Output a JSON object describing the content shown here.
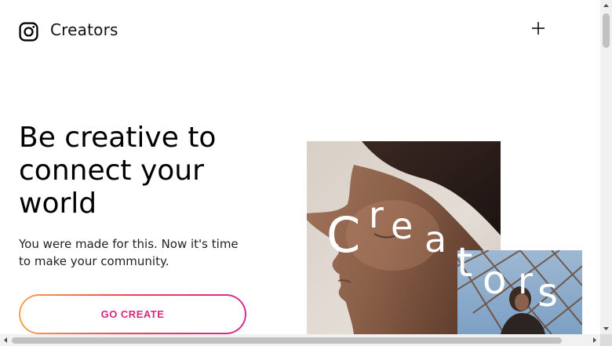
{
  "header": {
    "brand": "Creators",
    "logo_icon": "instagram-logo-icon",
    "menu_icon": "plus-icon"
  },
  "hero": {
    "title_lines": [
      "Be creative to",
      "connect your",
      "world"
    ],
    "subtitle_lines": [
      "You were made for this. Now it's time",
      "to make your community."
    ],
    "cta_label": "GO CREATE"
  },
  "artwork": {
    "letters": [
      "C",
      "r",
      "e",
      "a",
      "t",
      "o",
      "r",
      "s"
    ]
  },
  "colors": {
    "cta_gradient": [
      "#f7a34b",
      "#ef3f5c",
      "#d62a8b"
    ],
    "cta_text": "#d6297d"
  }
}
